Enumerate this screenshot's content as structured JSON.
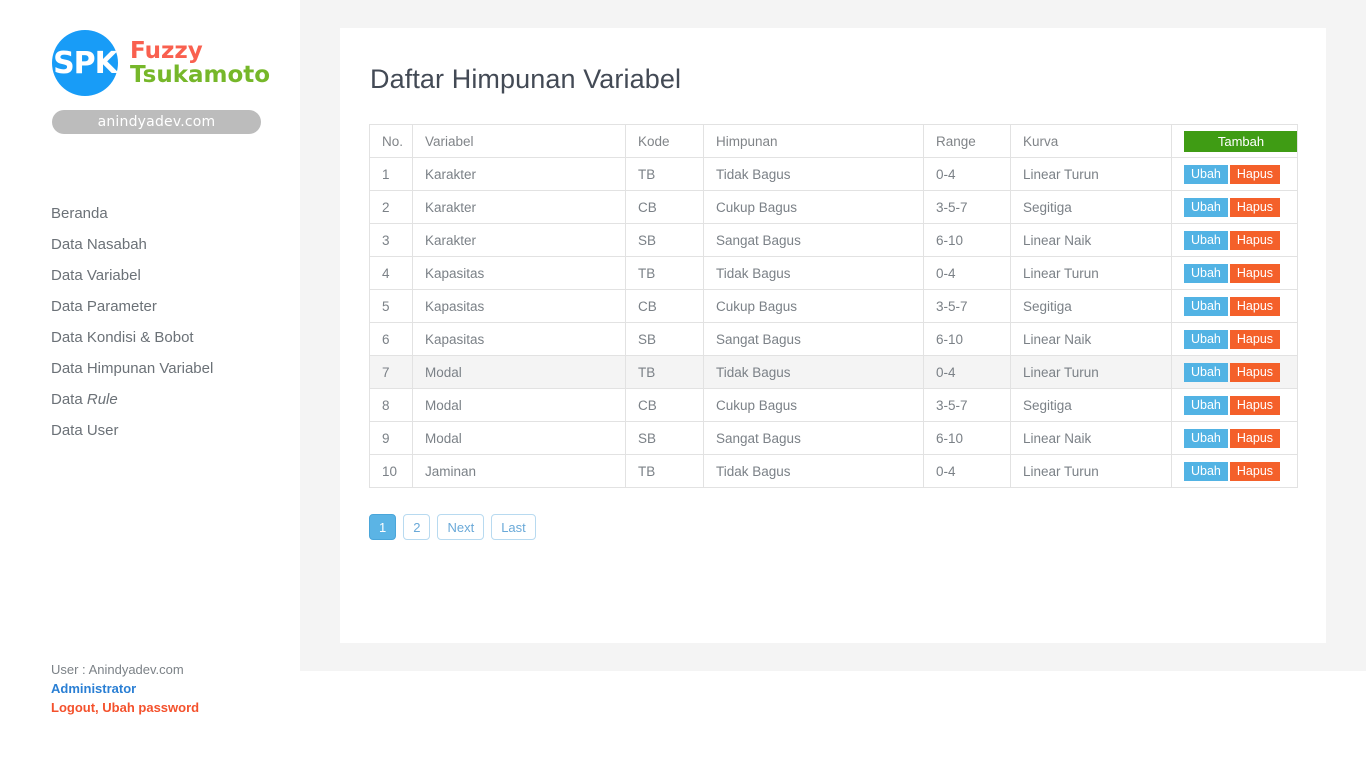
{
  "brand": {
    "logo_text": "SPK",
    "title_line1": "Fuzzy",
    "title_line2": "Tsukamoto",
    "domain_pill": "anindyadev.com",
    "logo_color": "#189cf7",
    "fuzzy_color": "#f9604f",
    "tsukamoto_color": "#76b72a"
  },
  "sidebar": {
    "items": [
      {
        "label": "Beranda",
        "italic": ""
      },
      {
        "label": "Data Nasabah",
        "italic": ""
      },
      {
        "label": "Data Variabel",
        "italic": ""
      },
      {
        "label": "Data Parameter",
        "italic": ""
      },
      {
        "label": "Data Kondisi & Bobot",
        "italic": ""
      },
      {
        "label": "Data Himpunan Variabel",
        "italic": ""
      },
      {
        "label": "Data ",
        "italic": "Rule"
      },
      {
        "label": "Data User",
        "italic": ""
      }
    ]
  },
  "user": {
    "line": "User : Anindyadev.com",
    "role": "Administrator",
    "logout": "Logout",
    "separator": ", ",
    "change_password": "Ubah password"
  },
  "main": {
    "page_title": "Daftar Himpunan Variabel",
    "add_button": "Tambah",
    "edit_button": "Ubah",
    "delete_button": "Hapus",
    "colors": {
      "add": "#3f9c14",
      "edit": "#52b3e4",
      "delete": "#f4602a"
    },
    "table": {
      "columns": [
        "No.",
        "Variabel",
        "Kode",
        "Himpunan",
        "Range",
        "Kurva"
      ],
      "rows": [
        {
          "no": "1",
          "variabel": "Karakter",
          "kode": "TB",
          "himpunan": "Tidak Bagus",
          "range": "0-4",
          "kurva": "Linear Turun",
          "highlight": false
        },
        {
          "no": "2",
          "variabel": "Karakter",
          "kode": "CB",
          "himpunan": "Cukup Bagus",
          "range": "3-5-7",
          "kurva": "Segitiga",
          "highlight": false
        },
        {
          "no": "3",
          "variabel": "Karakter",
          "kode": "SB",
          "himpunan": "Sangat Bagus",
          "range": "6-10",
          "kurva": "Linear Naik",
          "highlight": false
        },
        {
          "no": "4",
          "variabel": "Kapasitas",
          "kode": "TB",
          "himpunan": "Tidak Bagus",
          "range": "0-4",
          "kurva": "Linear Turun",
          "highlight": false
        },
        {
          "no": "5",
          "variabel": "Kapasitas",
          "kode": "CB",
          "himpunan": "Cukup Bagus",
          "range": "3-5-7",
          "kurva": "Segitiga",
          "highlight": false
        },
        {
          "no": "6",
          "variabel": "Kapasitas",
          "kode": "SB",
          "himpunan": "Sangat Bagus",
          "range": "6-10",
          "kurva": "Linear Naik",
          "highlight": false
        },
        {
          "no": "7",
          "variabel": "Modal",
          "kode": "TB",
          "himpunan": "Tidak Bagus",
          "range": "0-4",
          "kurva": "Linear Turun",
          "highlight": true
        },
        {
          "no": "8",
          "variabel": "Modal",
          "kode": "CB",
          "himpunan": "Cukup Bagus",
          "range": "3-5-7",
          "kurva": "Segitiga",
          "highlight": false
        },
        {
          "no": "9",
          "variabel": "Modal",
          "kode": "SB",
          "himpunan": "Sangat Bagus",
          "range": "6-10",
          "kurva": "Linear Naik",
          "highlight": false
        },
        {
          "no": "10",
          "variabel": "Jaminan",
          "kode": "TB",
          "himpunan": "Tidak Bagus",
          "range": "0-4",
          "kurva": "Linear Turun",
          "highlight": false
        }
      ]
    },
    "pagination": [
      {
        "label": "1",
        "active": true
      },
      {
        "label": "2",
        "active": false
      },
      {
        "label": "Next",
        "active": false
      },
      {
        "label": "Last",
        "active": false
      }
    ]
  }
}
